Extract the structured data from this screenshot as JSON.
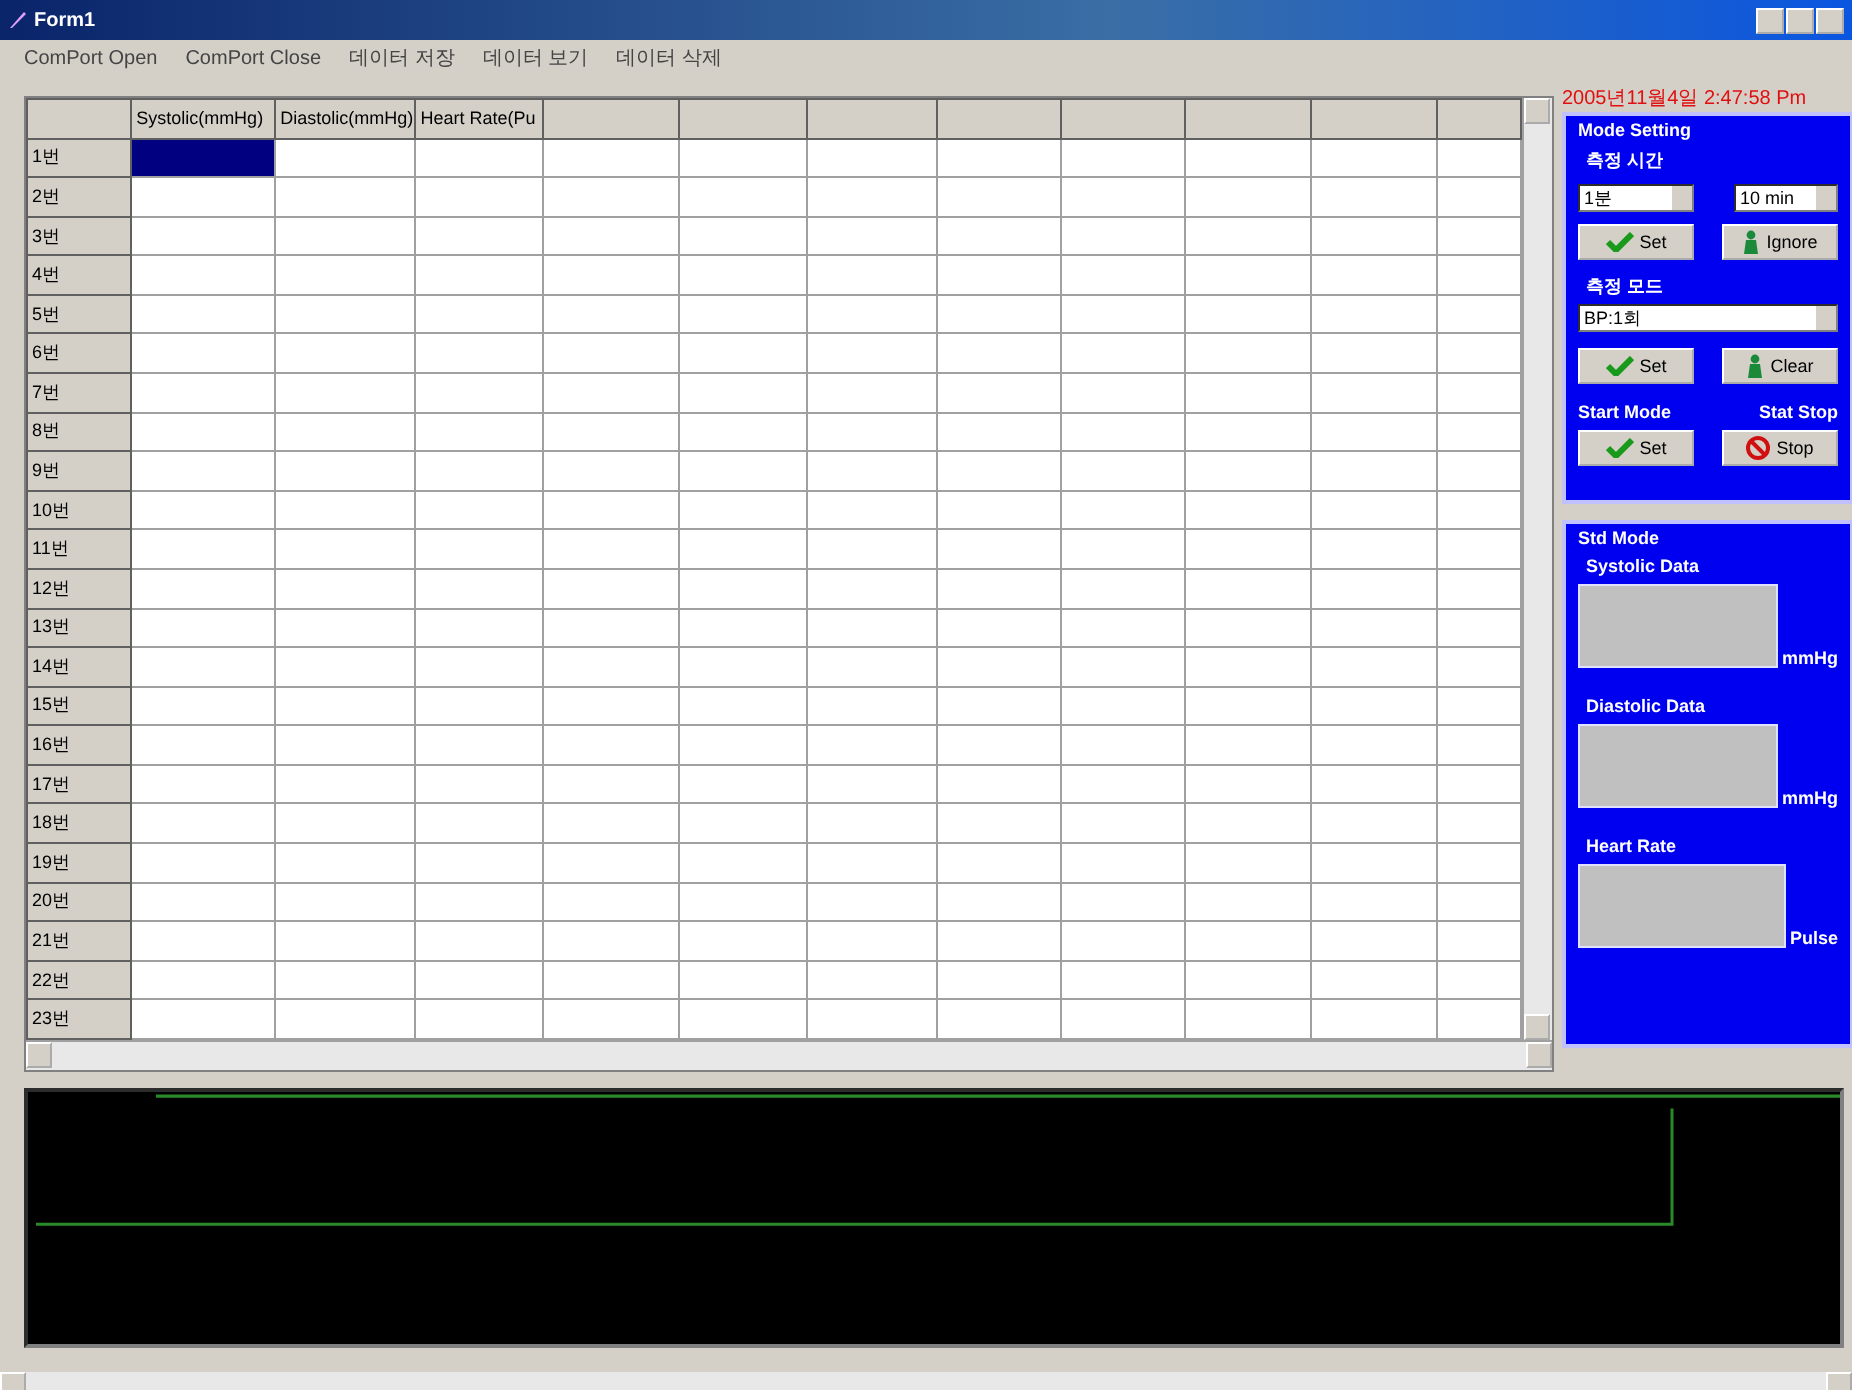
{
  "window": {
    "title": "Form1"
  },
  "menu": [
    "ComPort Open",
    "ComPort Close",
    "데이터 저장",
    "데이터 보기",
    "데이터 삭제"
  ],
  "grid": {
    "columns": [
      "Systolic(mmHg)",
      "Diastolic(mmHg)",
      "Heart Rate(Pu"
    ],
    "rows": [
      {
        "label": "1번",
        "selected": true
      },
      {
        "label": "2번",
        "selected": false
      },
      {
        "label": "3번",
        "selected": false
      },
      {
        "label": "4번",
        "selected": false
      },
      {
        "label": "5번",
        "selected": false
      },
      {
        "label": "6번",
        "selected": false
      },
      {
        "label": "7번",
        "selected": false
      },
      {
        "label": "8번",
        "selected": false
      },
      {
        "label": "9번",
        "selected": false
      },
      {
        "label": "10번",
        "selected": false
      },
      {
        "label": "11번",
        "selected": false
      },
      {
        "label": "12번",
        "selected": false
      },
      {
        "label": "13번",
        "selected": false
      },
      {
        "label": "14번",
        "selected": false
      },
      {
        "label": "15번",
        "selected": false
      },
      {
        "label": "16번",
        "selected": false
      },
      {
        "label": "17번",
        "selected": false
      },
      {
        "label": "18번",
        "selected": false
      },
      {
        "label": "19번",
        "selected": false
      },
      {
        "label": "20번",
        "selected": false
      },
      {
        "label": "21번",
        "selected": false
      },
      {
        "label": "22번",
        "selected": false
      },
      {
        "label": "23번",
        "selected": false
      }
    ]
  },
  "clock": "2005년11월4일 2:47:58 Pm",
  "mode_setting": {
    "title": "Mode Setting",
    "interval_label": "측정 시간",
    "interval_values": [
      "1분",
      "10 min"
    ],
    "interval_buttons": [
      {
        "label": "Set",
        "kind": "check"
      },
      {
        "label": "Ignore",
        "kind": "person"
      }
    ],
    "mode_label": "측정 모드",
    "mode_value": "BP:1회",
    "mode_buttons": [
      {
        "label": "Set",
        "kind": "check"
      },
      {
        "label": "Clear",
        "kind": "person"
      }
    ],
    "start_label": "Start Mode",
    "stop_label": "Stat Stop",
    "run_buttons": [
      {
        "label": "Set",
        "kind": "check"
      },
      {
        "label": "Stop",
        "kind": "stop"
      }
    ]
  },
  "std_mode": {
    "title": "Std Mode",
    "readings": [
      {
        "label": "Systolic Data",
        "unit": "mmHg"
      },
      {
        "label": "Diastolic Data",
        "unit": "mmHg"
      },
      {
        "label": "Heart Rate",
        "unit": "Pulse"
      }
    ]
  }
}
